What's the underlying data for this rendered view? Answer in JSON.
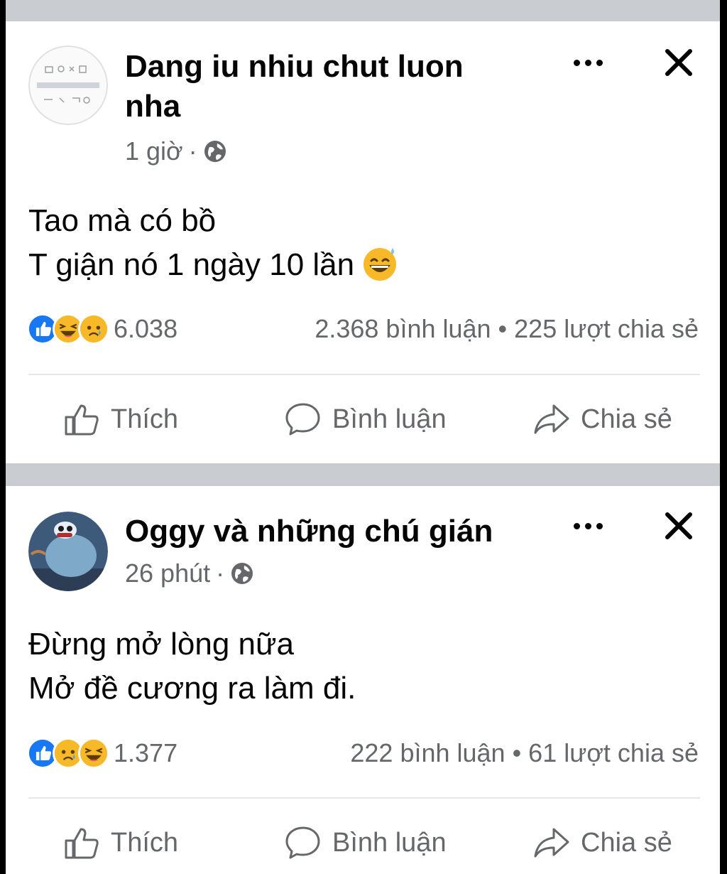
{
  "posts": [
    {
      "author": "Dang iu nhiu chut luon nha",
      "time": "1 giờ",
      "separator": "·",
      "body_lines": [
        "Tao mà có bồ",
        "T giận nó 1 ngày 10 lần"
      ],
      "body_emoji": "grinning-sweat-emoji",
      "reactions": [
        "like",
        "haha",
        "sad"
      ],
      "reaction_count": "6.038",
      "comments_shares": "2.368 bình luận • 225 lượt chia sẻ",
      "avatar": "doodle-logo-avatar"
    },
    {
      "author": "Oggy và những chú gián",
      "time": "26 phút",
      "separator": "·",
      "body_lines": [
        "Đừng mở lòng nữa",
        "Mở đề cương ra làm đi."
      ],
      "reactions": [
        "like",
        "sad",
        "haha"
      ],
      "reaction_count": "1.377",
      "comments_shares": "222 bình luận • 61 lượt chia sẻ",
      "avatar": "cartoon-cat-avatar"
    }
  ],
  "actions": {
    "like": "Thích",
    "comment": "Bình luận",
    "share": "Chia sẻ"
  },
  "colors": {
    "background": "#ffffff",
    "separator_gray": "#c9ccd1",
    "meta_gray": "#65676b",
    "like_blue": "#1877f2",
    "emoji_yellow": "#f7b928"
  }
}
